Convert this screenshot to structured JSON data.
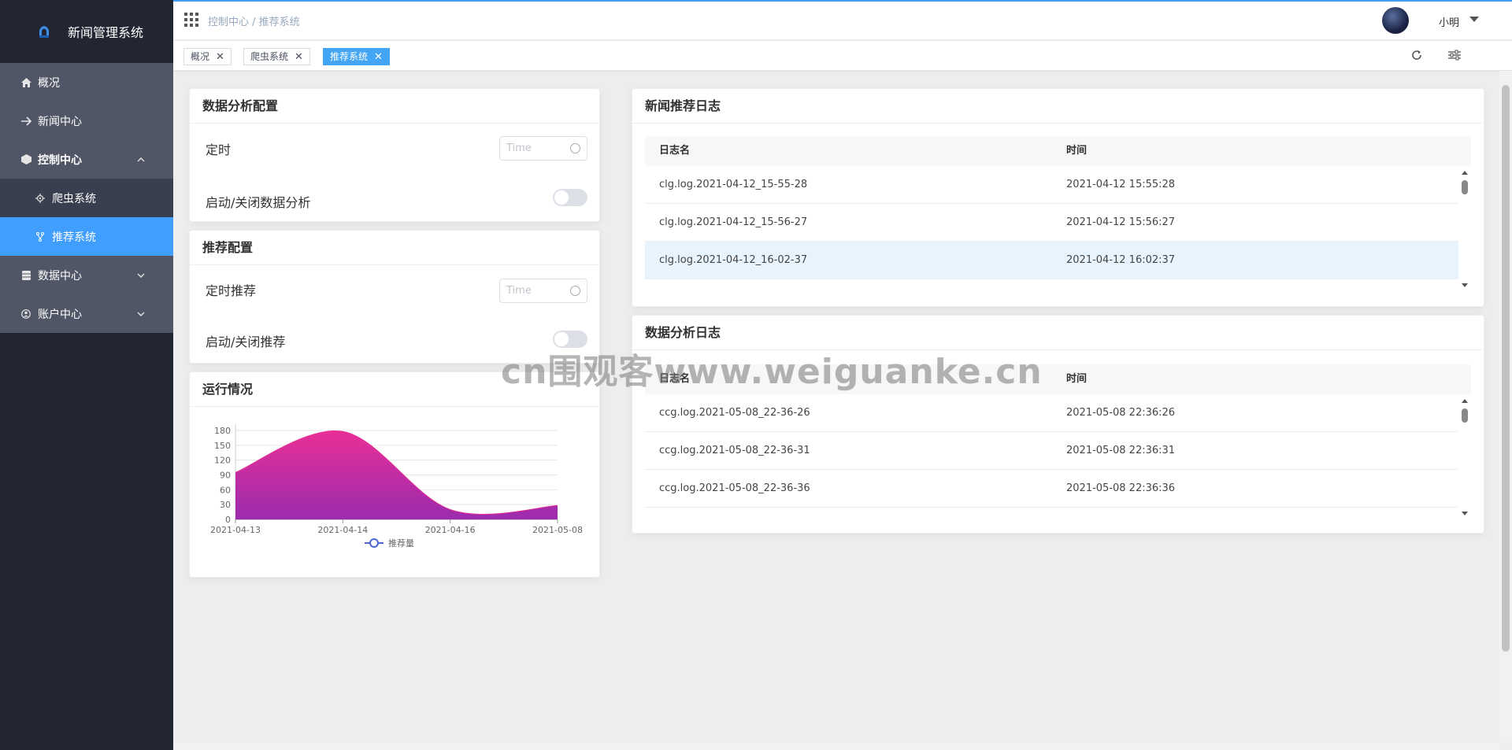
{
  "app": {
    "title": "新闻管理系统"
  },
  "sidebar": {
    "items": [
      {
        "label": "概况",
        "icon": "home-icon"
      },
      {
        "label": "新闻中心",
        "icon": "arrow-right-icon"
      },
      {
        "label": "控制中心",
        "icon": "cube-icon",
        "expanded": true,
        "children": [
          {
            "label": "爬虫系统",
            "icon": "gear-icon"
          },
          {
            "label": "推荐系统",
            "icon": "branch-icon",
            "active": true
          }
        ]
      },
      {
        "label": "数据中心",
        "icon": "database-icon"
      },
      {
        "label": "账户中心",
        "icon": "user-icon"
      }
    ]
  },
  "header": {
    "breadcrumb": "控制中心 / 推荐系统",
    "username": "小明"
  },
  "tabs": [
    {
      "label": "概况",
      "close": "✕"
    },
    {
      "label": "爬虫系统",
      "close": "✕"
    },
    {
      "label": "推荐系统",
      "close": "✕",
      "active": true
    }
  ],
  "analysis_config": {
    "title": "数据分析配置",
    "timer_label": "定时",
    "timer_placeholder": "Time",
    "switch_label": "启动/关闭数据分析",
    "switch_on": false
  },
  "recommend_config": {
    "title": "推荐配置",
    "timer_label": "定时推荐",
    "timer_placeholder": "Time",
    "switch_label": "启动/关闭推荐",
    "switch_on": false
  },
  "status_card": {
    "title": "运行情况"
  },
  "chart_data": {
    "type": "area",
    "x": [
      "2021-04-13",
      "2021-04-14",
      "2021-04-16",
      "2021-05-08"
    ],
    "series": [
      {
        "name": "推荐量",
        "values": [
          95,
          178,
          20,
          28
        ]
      }
    ],
    "yticks": [
      0,
      30,
      60,
      90,
      120,
      150,
      180
    ],
    "ylim": [
      0,
      180
    ],
    "colors": {
      "top": "#e92e96",
      "bottom": "#9b2cae",
      "legend": "#4b67d6"
    },
    "legend_position": "bottom-center",
    "grid": true
  },
  "news_log": {
    "title": "新闻推荐日志",
    "columns": [
      "日志名",
      "时间"
    ],
    "rows": [
      {
        "name": "clg.log.2021-04-12_15-55-28",
        "time": "2021-04-12 15:55:28"
      },
      {
        "name": "clg.log.2021-04-12_15-56-27",
        "time": "2021-04-12 15:56:27"
      },
      {
        "name": "clg.log.2021-04-12_16-02-37",
        "time": "2021-04-12 16:02:37"
      }
    ]
  },
  "data_log": {
    "title": "数据分析日志",
    "columns": [
      "日志名",
      "时间"
    ],
    "rows": [
      {
        "name": "ccg.log.2021-05-08_22-36-26",
        "time": "2021-05-08 22:36:26"
      },
      {
        "name": "ccg.log.2021-05-08_22-36-31",
        "time": "2021-05-08 22:36:31"
      },
      {
        "name": "ccg.log.2021-05-08_22-36-36",
        "time": "2021-05-08 22:36:36"
      }
    ]
  },
  "watermark": "cn围观客www.weiguanke.cn",
  "colors": {
    "accent": "#409eff",
    "sidebar_bg": "#222633",
    "menu_bg": "#505666",
    "active_tab": "#42a5f5"
  }
}
